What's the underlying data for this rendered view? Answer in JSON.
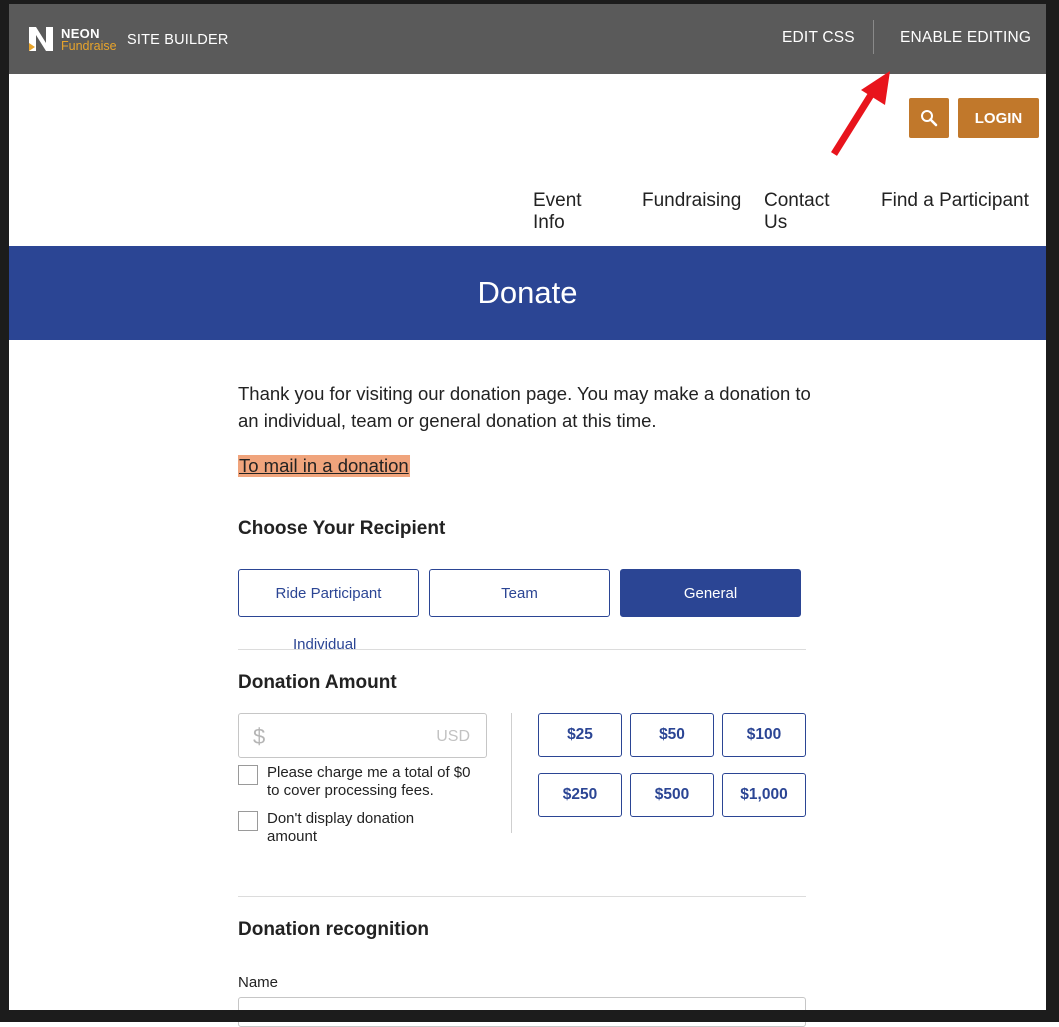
{
  "topbar": {
    "brand_line1": "NEON",
    "brand_line2": "Fundraise",
    "site_builder": "SITE BUILDER",
    "edit_css": "EDIT CSS",
    "enable_editing": "ENABLE EDITING"
  },
  "header": {
    "login": "LOGIN",
    "nav": [
      "Event Info",
      "Fundraising",
      "Contact Us",
      "Find a Participant"
    ]
  },
  "banner": {
    "title": "Donate"
  },
  "intro": {
    "text": "Thank you for visiting our donation page.  You may make a donation to an individual, team or general donation at this time.",
    "mail_link": "To mail in a donation"
  },
  "recipient": {
    "heading": "Choose Your Recipient",
    "options": [
      "Ride Participant",
      "Team",
      "General"
    ],
    "selected": "General",
    "individual_label": "Individual"
  },
  "amount": {
    "heading": "Donation Amount",
    "currency_symbol": "$",
    "currency_code": "USD",
    "fee_label": "Please charge me a total of $0 to cover processing fees.",
    "hide_label": "Don't display donation amount",
    "presets": [
      "$25",
      "$50",
      "$100",
      "$250",
      "$500",
      "$1,000"
    ]
  },
  "recognition": {
    "heading": "Donation recognition",
    "name_label": "Name"
  },
  "colors": {
    "topbar": "#5a5a5a",
    "brand_accent": "#e8a42b",
    "primary": "#2b4594",
    "action": "#c1782b",
    "highlight": "#f0a47c",
    "annotation_arrow": "#e8141c"
  }
}
